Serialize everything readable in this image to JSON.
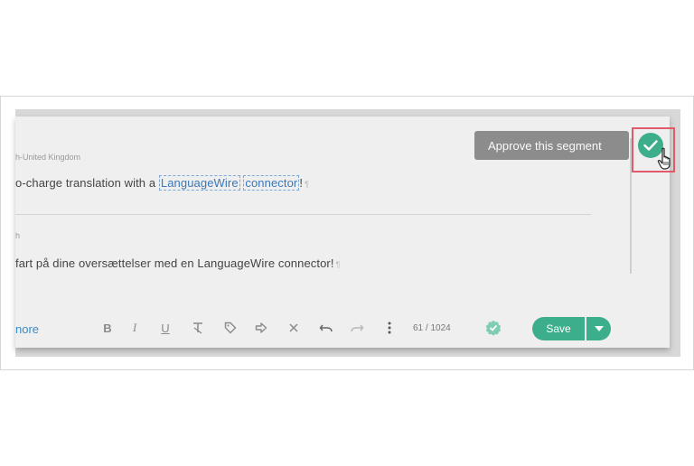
{
  "segment": {
    "source_language": "h-United Kingdom",
    "source_text_before": "o-charge translation with a ",
    "source_term_1": "LanguageWire",
    "source_term_2": "connector",
    "source_text_after": "!",
    "target_language": "h",
    "target_text": "fart på dine oversættelser med en LanguageWire connector!",
    "pilcrow": "¶"
  },
  "toolbar": {
    "more_label": "nore",
    "bold": "B",
    "italic": "I",
    "underline": "U",
    "char_count": "61 / 1024",
    "save_label": "Save"
  },
  "approve": {
    "tooltip": "Approve this segment"
  },
  "colors": {
    "accent": "#3dae8c",
    "highlight_border": "#e05a6a",
    "tooltip_bg": "#8c8c8c",
    "link": "#3a8ac8"
  }
}
